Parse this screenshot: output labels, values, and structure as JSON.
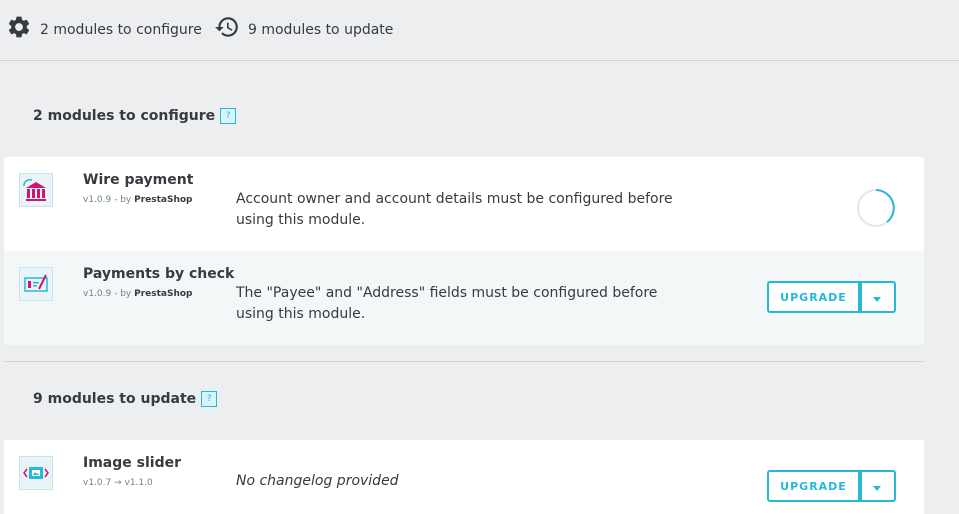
{
  "tabs": [
    {
      "label": "2 modules to configure",
      "icon": "gear-icon"
    },
    {
      "label": "9 modules to update",
      "icon": "history-icon"
    }
  ],
  "configure_section": {
    "title": "2 modules to configure",
    "help": "?",
    "modules": [
      {
        "name": "Wire payment",
        "version": "v1.0.9 - by",
        "author": "PrestaShop",
        "description": "Account owner and account details must be configured before using this module.",
        "status": "loading"
      },
      {
        "name": "Payments by check",
        "version": "v1.0.9 - by",
        "author": "PrestaShop",
        "description": "The \"Payee\" and \"Address\" fields must be configured before using this module.",
        "action_label": "UPGRADE"
      }
    ]
  },
  "update_section": {
    "title": "9 modules to update",
    "help": "?",
    "modules": [
      {
        "name": "Image slider",
        "version": "v1.0.7 → v1.1.0",
        "description": "No changelog provided",
        "action_label": "UPGRADE"
      }
    ]
  },
  "colors": {
    "accent": "#25b9d7",
    "text": "#363a41",
    "muted": "#6c868e",
    "background": "#eceeef",
    "logo_pink": "#d4136d"
  }
}
